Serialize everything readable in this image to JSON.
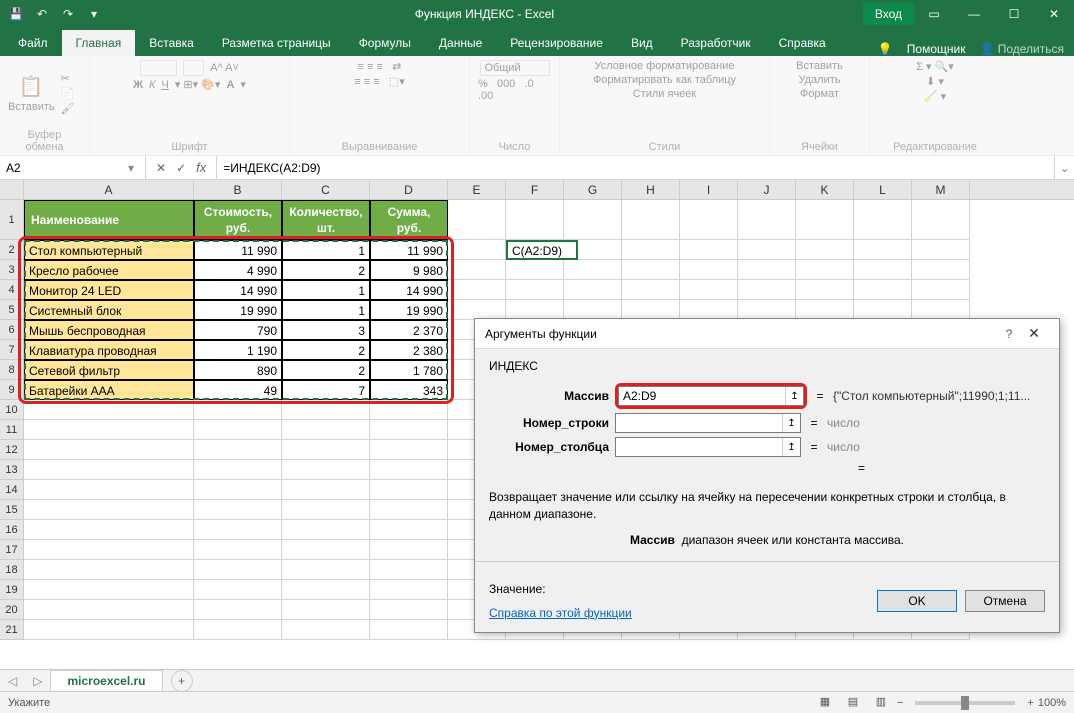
{
  "titlebar": {
    "title": "Функция ИНДЕКС - Excel",
    "signin": "Вход"
  },
  "tabs": {
    "file": "Файл",
    "home": "Главная",
    "insert": "Вставка",
    "layout": "Разметка страницы",
    "formulas": "Формулы",
    "data": "Данные",
    "review": "Рецензирование",
    "view": "Вид",
    "developer": "Разработчик",
    "help": "Справка",
    "assistant": "Помощник",
    "share": "Поделиться"
  },
  "ribbon": {
    "paste": "Вставить",
    "clipboard": "Буфер обмена",
    "font": "Шрифт",
    "alignment": "Выравнивание",
    "number": "Число",
    "number_format": "Общий",
    "styles": "Стили",
    "cond_fmt": "Условное форматирование",
    "fmt_table": "Форматировать как таблицу",
    "cell_styles": "Стили ячеек",
    "cells": "Ячейки",
    "insert_btn": "Вставить",
    "delete_btn": "Удалить",
    "format_btn": "Формат",
    "editing": "Редактирование"
  },
  "formula_bar": {
    "namebox": "A2",
    "formula": "=ИНДЕКС(A2:D9)"
  },
  "columns": [
    "A",
    "B",
    "C",
    "D",
    "E",
    "F",
    "G",
    "H",
    "I",
    "J",
    "K",
    "L",
    "M"
  ],
  "headers": {
    "name": "Наименование",
    "cost": "Стоимость, руб.",
    "qty": "Количество, шт.",
    "sum": "Сумма, руб."
  },
  "rows": [
    {
      "name": "Стол компьютерный",
      "cost": "11 990",
      "qty": "1",
      "sum": "11 990"
    },
    {
      "name": "Кресло рабочее",
      "cost": "4 990",
      "qty": "2",
      "sum": "9 980"
    },
    {
      "name": "Монитор 24 LED",
      "cost": "14 990",
      "qty": "1",
      "sum": "14 990"
    },
    {
      "name": "Системный блок",
      "cost": "19 990",
      "qty": "1",
      "sum": "19 990"
    },
    {
      "name": "Мышь беспроводная",
      "cost": "790",
      "qty": "3",
      "sum": "2 370"
    },
    {
      "name": "Клавиатура проводная",
      "cost": "1 190",
      "qty": "2",
      "sum": "2 380"
    },
    {
      "name": "Сетевой фильтр",
      "cost": "890",
      "qty": "2",
      "sum": "1 780"
    },
    {
      "name": "Батарейки AAA",
      "cost": "49",
      "qty": "7",
      "sum": "343"
    }
  ],
  "active_cell_text": "С(A2:D9)",
  "dialog": {
    "title": "Аргументы функции",
    "fn": "ИНДЕКС",
    "arg1_label": "Массив",
    "arg1_value": "A2:D9",
    "arg1_result": "{\"Стол компьютерный\";11990;1;11...",
    "arg2_label": "Номер_строки",
    "arg2_result": "число",
    "arg3_label": "Номер_столбца",
    "arg3_result": "число",
    "desc": "Возвращает значение или ссылку на ячейку на пересечении конкретных строки и столбца, в данном диапазоне.",
    "arg_desc_label": "Массив",
    "arg_desc": "диапазон ячеек или константа массива.",
    "value_label": "Значение:",
    "help_link": "Справка по этой функции",
    "ok": "OK",
    "cancel": "Отмена"
  },
  "sheet": {
    "name": "microexcel.ru"
  },
  "status": {
    "mode": "Укажите",
    "zoom": "100%"
  }
}
